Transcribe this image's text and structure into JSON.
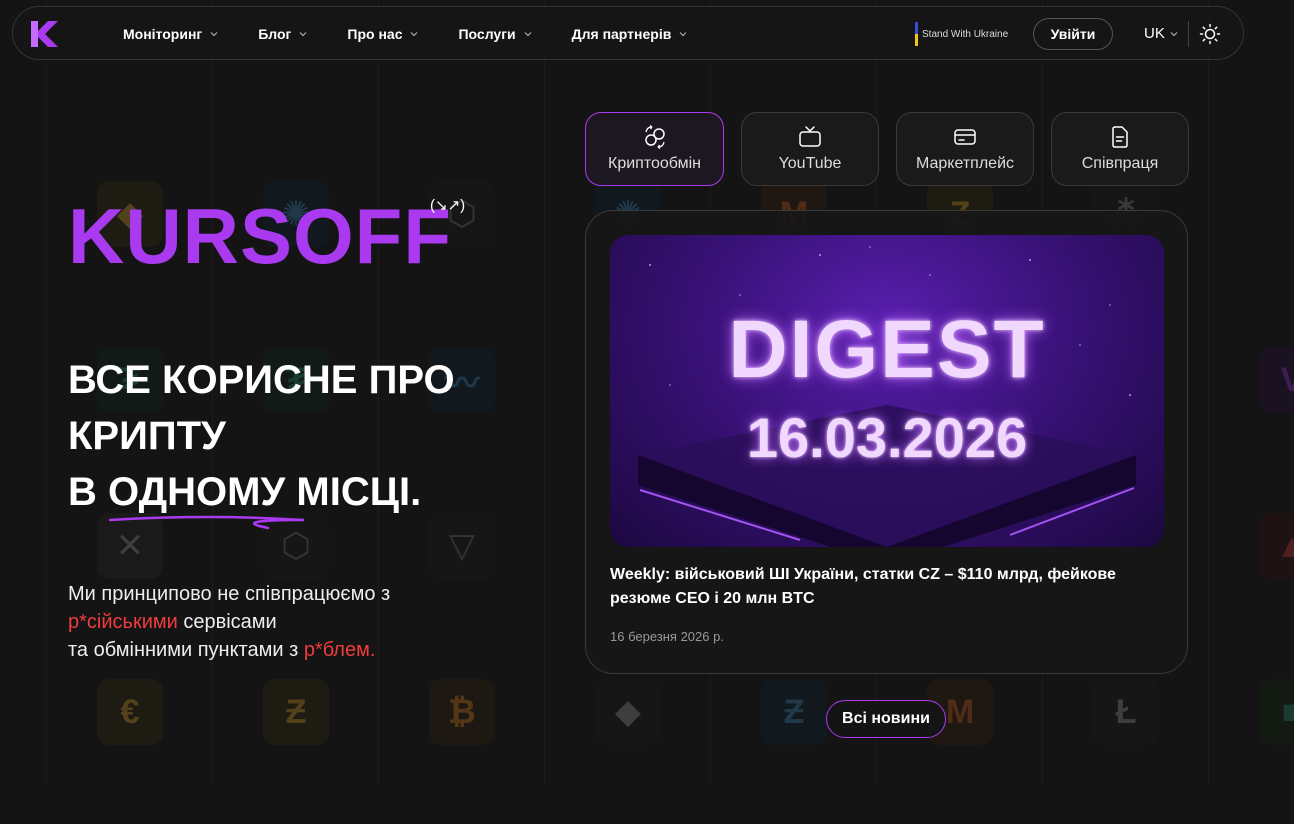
{
  "nav": {
    "logo": "kursoff-logo-icon",
    "items": [
      {
        "label": "Моніторинг"
      },
      {
        "label": "Блог"
      },
      {
        "label": "Про нас"
      },
      {
        "label": "Послуги"
      },
      {
        "label": "Для партнерів"
      }
    ],
    "stand_with_ukraine": "Stand With Ukraine",
    "login_label": "Увійти",
    "language": "UK",
    "theme_icon": "sun-icon"
  },
  "hero": {
    "brand": "KURSOFF",
    "brand_sup": "(↘↗)",
    "headline_line1": "Все корисне про",
    "headline_line2": "крипту",
    "headline_line3_pre": "в ",
    "headline_line3_under": "одному",
    "headline_line3_post": " місці.",
    "sub_line1": "Ми принципово не співпрацюємо з",
    "sub_red1": "р*сійськими",
    "sub_line2": " сервісами",
    "sub_line3": "та обмінними пунктами з ",
    "sub_red2": "р*блем."
  },
  "tabs": [
    {
      "label": "Криптообмін",
      "icon": "exchange-icon",
      "active": true
    },
    {
      "label": "YouTube",
      "icon": "tv-icon",
      "active": false
    },
    {
      "label": "Маркетплейс",
      "icon": "card-icon",
      "active": false
    },
    {
      "label": "Співпраця",
      "icon": "document-icon",
      "active": false
    }
  ],
  "news": {
    "image_title": "DIGEST",
    "image_date": "16.03.2026",
    "title": "Weekly: військовий ШІ України, статки CZ – $110 млрд, фейкове резюме CEO і 20 млн BTC",
    "date": "16 березня 2026 р."
  },
  "all_news_label": "Всі новини",
  "colors": {
    "accent": "#a93af0",
    "danger": "#f03c3c",
    "background": "#141414"
  }
}
